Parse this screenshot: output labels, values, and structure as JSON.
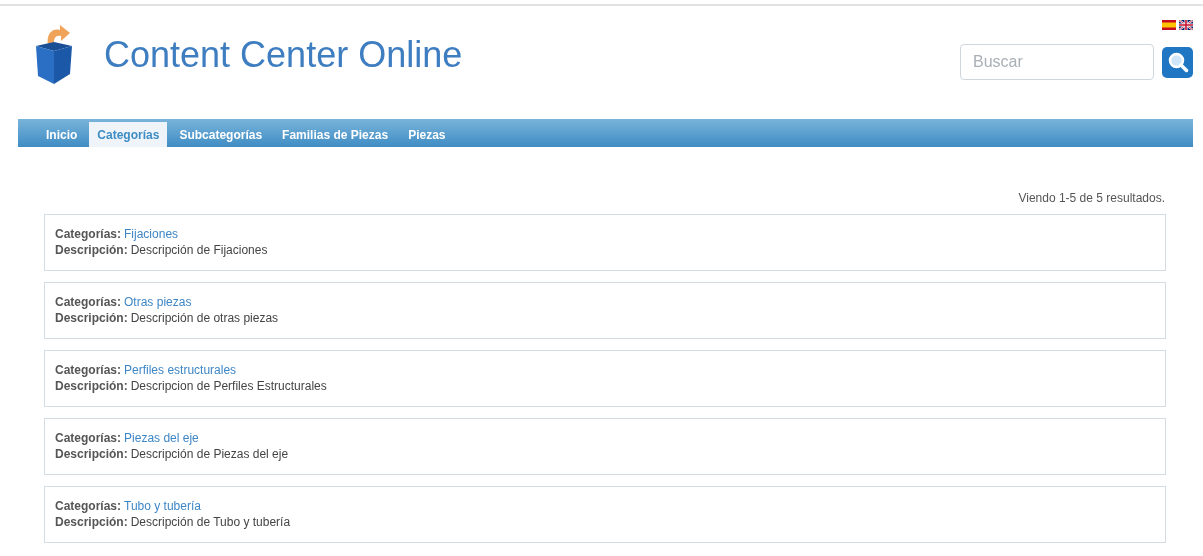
{
  "header": {
    "title": "Content Center Online",
    "languages": [
      {
        "kind": "spanish"
      },
      {
        "kind": "english"
      }
    ],
    "search": {
      "placeholder": "Buscar"
    }
  },
  "nav": [
    {
      "label": "Inicio",
      "selected": false
    },
    {
      "label": "Categorías",
      "selected": true
    },
    {
      "label": "Subcategorías",
      "selected": false
    },
    {
      "label": "Familias de Piezas",
      "selected": false
    },
    {
      "label": "Piezas",
      "selected": false
    }
  ],
  "summary": "Viendo 1-5 de 5 resultados.",
  "results": [
    {
      "category_label": "Categorías:",
      "category": "Fijaciones",
      "description_label": "Descripción:",
      "description": "Descripción de Fijaciones"
    },
    {
      "category_label": "Categorías:",
      "category": "Otras piezas",
      "description_label": "Descripción:",
      "description": "Descripción de otras piezas"
    },
    {
      "category_label": "Categorías:",
      "category": "Perfiles estructurales",
      "description_label": "Descripción:",
      "description": "Descripcion de Perfiles Estructurales"
    },
    {
      "category_label": "Categorías:",
      "category": "Piezas del eje",
      "description_label": "Descripción:",
      "description": "Descripción de Piezas del eje"
    },
    {
      "category_label": "Categorías:",
      "category": "Tubo y tubería",
      "description_label": "Descripción:",
      "description": "Descripción de Tubo y tubería"
    }
  ]
}
